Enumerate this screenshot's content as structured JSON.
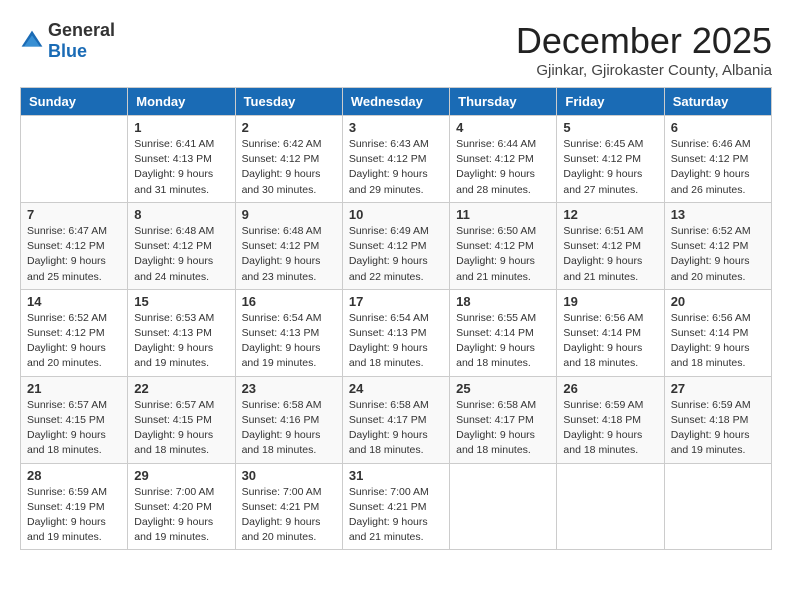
{
  "logo": {
    "general": "General",
    "blue": "Blue"
  },
  "title": "December 2025",
  "location": "Gjinkar, Gjirokaster County, Albania",
  "days_of_week": [
    "Sunday",
    "Monday",
    "Tuesday",
    "Wednesday",
    "Thursday",
    "Friday",
    "Saturday"
  ],
  "weeks": [
    [
      {
        "day": "",
        "sunrise": "",
        "sunset": "",
        "daylight": ""
      },
      {
        "day": "1",
        "sunrise": "Sunrise: 6:41 AM",
        "sunset": "Sunset: 4:13 PM",
        "daylight": "Daylight: 9 hours and 31 minutes."
      },
      {
        "day": "2",
        "sunrise": "Sunrise: 6:42 AM",
        "sunset": "Sunset: 4:12 PM",
        "daylight": "Daylight: 9 hours and 30 minutes."
      },
      {
        "day": "3",
        "sunrise": "Sunrise: 6:43 AM",
        "sunset": "Sunset: 4:12 PM",
        "daylight": "Daylight: 9 hours and 29 minutes."
      },
      {
        "day": "4",
        "sunrise": "Sunrise: 6:44 AM",
        "sunset": "Sunset: 4:12 PM",
        "daylight": "Daylight: 9 hours and 28 minutes."
      },
      {
        "day": "5",
        "sunrise": "Sunrise: 6:45 AM",
        "sunset": "Sunset: 4:12 PM",
        "daylight": "Daylight: 9 hours and 27 minutes."
      },
      {
        "day": "6",
        "sunrise": "Sunrise: 6:46 AM",
        "sunset": "Sunset: 4:12 PM",
        "daylight": "Daylight: 9 hours and 26 minutes."
      }
    ],
    [
      {
        "day": "7",
        "sunrise": "Sunrise: 6:47 AM",
        "sunset": "Sunset: 4:12 PM",
        "daylight": "Daylight: 9 hours and 25 minutes."
      },
      {
        "day": "8",
        "sunrise": "Sunrise: 6:48 AM",
        "sunset": "Sunset: 4:12 PM",
        "daylight": "Daylight: 9 hours and 24 minutes."
      },
      {
        "day": "9",
        "sunrise": "Sunrise: 6:48 AM",
        "sunset": "Sunset: 4:12 PM",
        "daylight": "Daylight: 9 hours and 23 minutes."
      },
      {
        "day": "10",
        "sunrise": "Sunrise: 6:49 AM",
        "sunset": "Sunset: 4:12 PM",
        "daylight": "Daylight: 9 hours and 22 minutes."
      },
      {
        "day": "11",
        "sunrise": "Sunrise: 6:50 AM",
        "sunset": "Sunset: 4:12 PM",
        "daylight": "Daylight: 9 hours and 21 minutes."
      },
      {
        "day": "12",
        "sunrise": "Sunrise: 6:51 AM",
        "sunset": "Sunset: 4:12 PM",
        "daylight": "Daylight: 9 hours and 21 minutes."
      },
      {
        "day": "13",
        "sunrise": "Sunrise: 6:52 AM",
        "sunset": "Sunset: 4:12 PM",
        "daylight": "Daylight: 9 hours and 20 minutes."
      }
    ],
    [
      {
        "day": "14",
        "sunrise": "Sunrise: 6:52 AM",
        "sunset": "Sunset: 4:12 PM",
        "daylight": "Daylight: 9 hours and 20 minutes."
      },
      {
        "day": "15",
        "sunrise": "Sunrise: 6:53 AM",
        "sunset": "Sunset: 4:13 PM",
        "daylight": "Daylight: 9 hours and 19 minutes."
      },
      {
        "day": "16",
        "sunrise": "Sunrise: 6:54 AM",
        "sunset": "Sunset: 4:13 PM",
        "daylight": "Daylight: 9 hours and 19 minutes."
      },
      {
        "day": "17",
        "sunrise": "Sunrise: 6:54 AM",
        "sunset": "Sunset: 4:13 PM",
        "daylight": "Daylight: 9 hours and 18 minutes."
      },
      {
        "day": "18",
        "sunrise": "Sunrise: 6:55 AM",
        "sunset": "Sunset: 4:14 PM",
        "daylight": "Daylight: 9 hours and 18 minutes."
      },
      {
        "day": "19",
        "sunrise": "Sunrise: 6:56 AM",
        "sunset": "Sunset: 4:14 PM",
        "daylight": "Daylight: 9 hours and 18 minutes."
      },
      {
        "day": "20",
        "sunrise": "Sunrise: 6:56 AM",
        "sunset": "Sunset: 4:14 PM",
        "daylight": "Daylight: 9 hours and 18 minutes."
      }
    ],
    [
      {
        "day": "21",
        "sunrise": "Sunrise: 6:57 AM",
        "sunset": "Sunset: 4:15 PM",
        "daylight": "Daylight: 9 hours and 18 minutes."
      },
      {
        "day": "22",
        "sunrise": "Sunrise: 6:57 AM",
        "sunset": "Sunset: 4:15 PM",
        "daylight": "Daylight: 9 hours and 18 minutes."
      },
      {
        "day": "23",
        "sunrise": "Sunrise: 6:58 AM",
        "sunset": "Sunset: 4:16 PM",
        "daylight": "Daylight: 9 hours and 18 minutes."
      },
      {
        "day": "24",
        "sunrise": "Sunrise: 6:58 AM",
        "sunset": "Sunset: 4:17 PM",
        "daylight": "Daylight: 9 hours and 18 minutes."
      },
      {
        "day": "25",
        "sunrise": "Sunrise: 6:58 AM",
        "sunset": "Sunset: 4:17 PM",
        "daylight": "Daylight: 9 hours and 18 minutes."
      },
      {
        "day": "26",
        "sunrise": "Sunrise: 6:59 AM",
        "sunset": "Sunset: 4:18 PM",
        "daylight": "Daylight: 9 hours and 18 minutes."
      },
      {
        "day": "27",
        "sunrise": "Sunrise: 6:59 AM",
        "sunset": "Sunset: 4:18 PM",
        "daylight": "Daylight: 9 hours and 19 minutes."
      }
    ],
    [
      {
        "day": "28",
        "sunrise": "Sunrise: 6:59 AM",
        "sunset": "Sunset: 4:19 PM",
        "daylight": "Daylight: 9 hours and 19 minutes."
      },
      {
        "day": "29",
        "sunrise": "Sunrise: 7:00 AM",
        "sunset": "Sunset: 4:20 PM",
        "daylight": "Daylight: 9 hours and 19 minutes."
      },
      {
        "day": "30",
        "sunrise": "Sunrise: 7:00 AM",
        "sunset": "Sunset: 4:21 PM",
        "daylight": "Daylight: 9 hours and 20 minutes."
      },
      {
        "day": "31",
        "sunrise": "Sunrise: 7:00 AM",
        "sunset": "Sunset: 4:21 PM",
        "daylight": "Daylight: 9 hours and 21 minutes."
      },
      {
        "day": "",
        "sunrise": "",
        "sunset": "",
        "daylight": ""
      },
      {
        "day": "",
        "sunrise": "",
        "sunset": "",
        "daylight": ""
      },
      {
        "day": "",
        "sunrise": "",
        "sunset": "",
        "daylight": ""
      }
    ]
  ]
}
